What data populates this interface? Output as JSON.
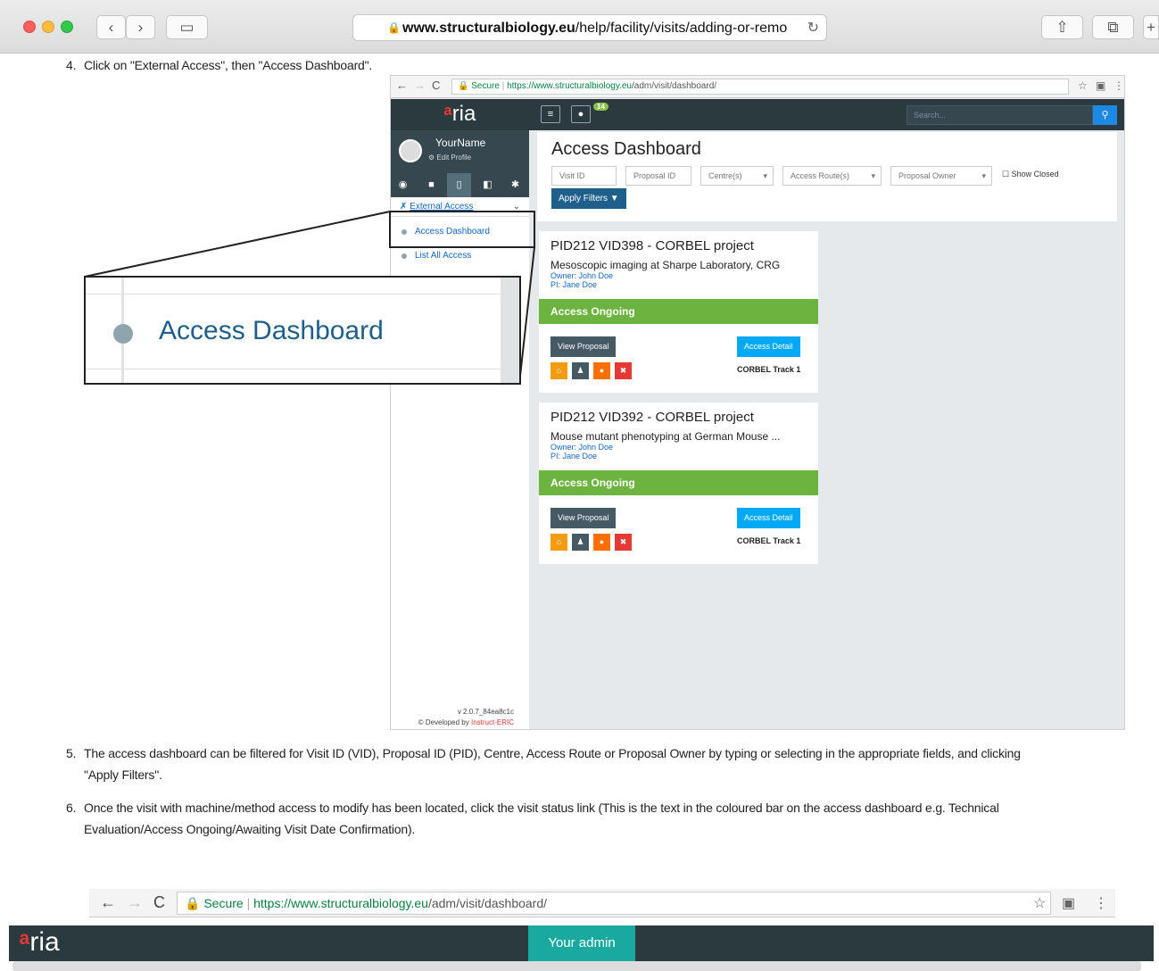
{
  "browser": {
    "url_domain": "www.structuralbiology.eu",
    "url_path": "/help/facility/visits/adding-or-remo",
    "reload_icon": "reload-icon",
    "share_icon": "share-icon",
    "tabs_icon": "tabs-icon"
  },
  "steps": {
    "s4_num": "4.",
    "s4": "Click on \"External Access\", then \"Access Dashboard\".",
    "s5_num": "5.",
    "s5_l1": "The access dashboard can be filtered for Visit ID (VID), Proposal ID (PID), Centre, Access Route or Proposal Owner by typing or selecting in the appropriate fields, and clicking",
    "s5_l2": "\"Apply Filters\".",
    "s6_num": "6.",
    "s6_l1": "Once the visit with machine/method access to modify has been located, click the visit status link (This is the text in the coloured bar on the access dashboard e.g. Technical",
    "s6_l2": "Evaluation/Access Ongoing/Awaiting Visit Date Confirmation)."
  },
  "screenshot1": {
    "secure": "Secure",
    "url_scheme": "https://www.structuralbiology.eu",
    "url_rest": "/adm/visit/dashboard/",
    "logo_rest": "ria",
    "user_name": "YourName",
    "edit_profile": "Edit Profile",
    "menu_header": "External Access",
    "menu_item1": "Access Dashboard",
    "menu_item2": "List All Access",
    "version": "v 2.0.7_84ea8c1c",
    "developed": "© Developed by",
    "developed_link": "Instruct-ERIC",
    "notif_count": "14",
    "search_placeholder": "Search...",
    "dashboard_title": "Access Dashboard",
    "filters": {
      "visit_id": "Visit ID",
      "proposal_id": "Proposal ID",
      "centres": "Centre(s)",
      "routes": "Access Route(s)",
      "owner": "Proposal Owner",
      "show_closed": "Show Closed",
      "apply": "Apply Filters"
    },
    "cards": [
      {
        "title": "PID212 VID398 - CORBEL project",
        "subtitle": "Mesoscopic imaging at Sharpe Laboratory, CRG",
        "owner": "Owner: John Doe",
        "pi": "PI: Jane Doe",
        "status": "Access Ongoing",
        "view": "View Proposal",
        "detail": "Access Detail",
        "track": "CORBEL Track 1"
      },
      {
        "title": "PID212 VID392 - CORBEL project",
        "subtitle": "Mouse mutant phenotyping at German Mouse ...",
        "owner": "Owner: John Doe",
        "pi": "PI: Jane Doe",
        "status": "Access Ongoing",
        "view": "View Proposal",
        "detail": "Access Detail",
        "track": "CORBEL Track 1"
      }
    ],
    "zoom_label": "Access Dashboard"
  },
  "screenshot2": {
    "secure": "Secure",
    "url_scheme": "https://www.structuralbiology.eu",
    "url_rest": "/adm/visit/dashboard/",
    "logo_rest": "ria",
    "admin": "Your admin"
  },
  "colors": {
    "status_green": "#6cb33f",
    "apply_blue": "#1f5f8b",
    "detail_blue": "#03a9f4",
    "nav_dark": "#2a3a3f",
    "admin_teal": "#1aa9a0"
  }
}
